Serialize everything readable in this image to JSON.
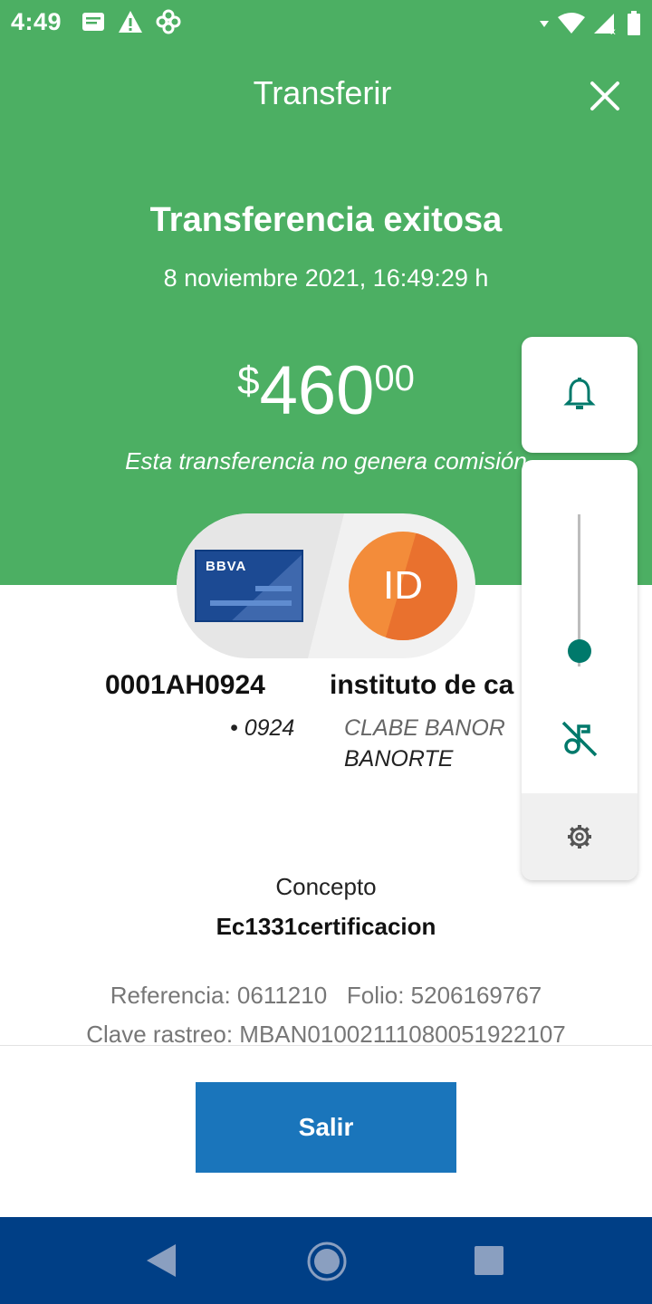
{
  "status_bar": {
    "time": "4:49",
    "left_icons": [
      "message-icon",
      "warning-icon",
      "fan-icon"
    ],
    "right_icons": [
      "signal-dot-icon",
      "wifi-icon",
      "cell-signal-icon",
      "battery-icon"
    ]
  },
  "header": {
    "title": "Transferir",
    "close_icon": "close-icon"
  },
  "result": {
    "title": "Transferencia exitosa",
    "datetime": "8 noviembre 2021, 16:49:29 h",
    "amount": {
      "currency": "$",
      "integer": "460",
      "decimals": "00"
    },
    "fee_note": "Esta transferencia no genera comisión"
  },
  "origin": {
    "bank_logo": "BBVA",
    "account": "0001AH0924",
    "masked": "• 0924"
  },
  "destination": {
    "initials": "ID",
    "name": "instituto de ca",
    "clabe": "CLABE BANOR",
    "bank": "BANORTE"
  },
  "details": {
    "concepto_label": "Concepto",
    "concepto_value": "Ec1331certificacion",
    "reference_line": "Referencia: 0611210   Folio: 5206169767",
    "clave_line": "Clave rastreo: MBAN01002111080051922107"
  },
  "actions": {
    "exit_label": "Salir"
  },
  "volume_panel": {
    "level": 0.1,
    "icons": [
      "bell-icon",
      "music-off-icon",
      "gear-icon"
    ]
  },
  "colors": {
    "header_green": "#4caf63",
    "button_blue": "#1a75bb",
    "nav_blue": "#003f86",
    "accent_teal": "#00796b"
  }
}
